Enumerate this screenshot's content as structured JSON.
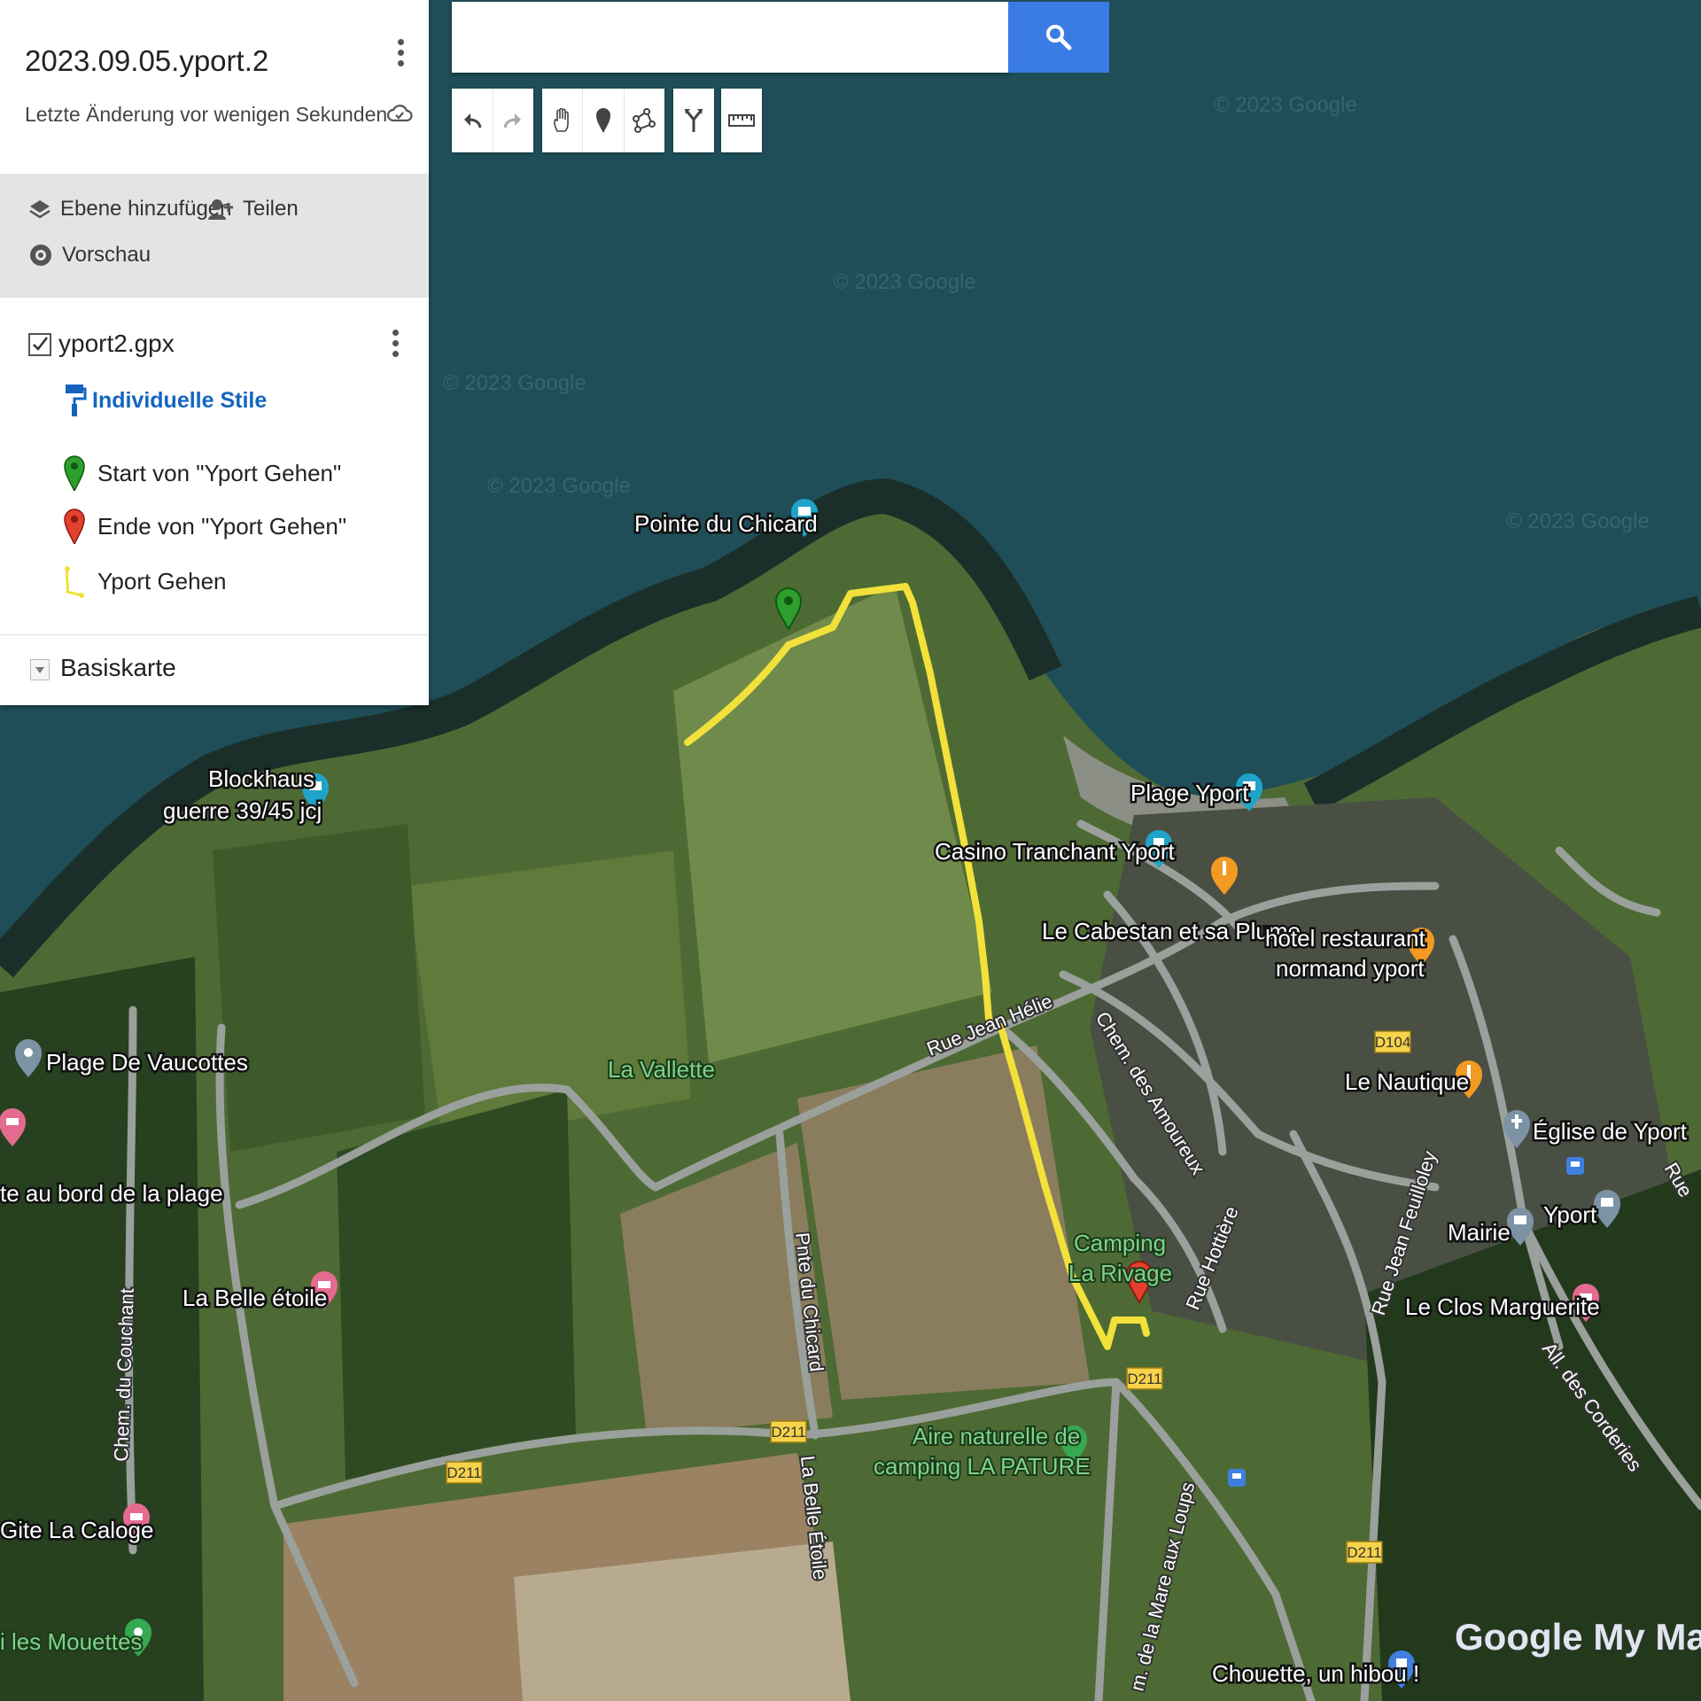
{
  "map_title": "2023.09.05.yport.2",
  "map_subtitle": "Letzte Änderung vor wenigen Sekunden",
  "actions": {
    "add_layer": "Ebene hinzufügen",
    "share": "Teilen",
    "preview": "Vorschau"
  },
  "layer": {
    "name": "yport2.gpx",
    "checked": true,
    "styles_label": "Individuelle Stile",
    "items": [
      {
        "label": "Start von \"Yport Gehen\"",
        "icon": "green-pin-icon",
        "color": "#2e9e2e"
      },
      {
        "label": "Ende von \"Yport Gehen\"",
        "icon": "red-pin-icon",
        "color": "#e3402f"
      },
      {
        "label": "Yport Gehen",
        "icon": "yellow-line-icon",
        "color": "#f1e13a"
      }
    ]
  },
  "basemap_label": "Basiskarte",
  "search": {
    "value": "",
    "placeholder": ""
  },
  "toolbar": [
    "undo-icon",
    "redo-icon",
    "hand-icon",
    "marker-icon",
    "draw-line-icon",
    "directions-icon",
    "ruler-icon"
  ],
  "map_labels": {
    "pointe": "Pointe du Chicard",
    "blockhaus_1": "Blockhaus",
    "blockhaus_2": "guerre 39/45 jcj",
    "plage_yport": "Plage Yport",
    "casino": "Casino Tranchant Yport",
    "cabestan": "Le Cabestan et sa Plume",
    "hotel_1": "hotel restaurant",
    "hotel_2": "normand yport",
    "vaucottes": "Plage De Vaucottes",
    "la_vallette": "La Vallette",
    "rue_jean_helie": "Rue Jean Hélie",
    "chem_amoureux": "Chem. des Amoureux",
    "le_nautique": "Le Nautique",
    "eglise": "Église de Yport",
    "bord_plage": "te au bord de la plage",
    "yport": "Yport",
    "mairie": "Mairie",
    "rue_feuilloley": "Rue Jean Feuilloley",
    "rue_hottiere": "Rue Hottière",
    "camping_1": "Camping",
    "camping_2": "La Rivage",
    "belle_etoile": "La Belle étoile",
    "chem_couchant": "Chem. du Couchant",
    "pnte_chicard": "Pnte du Chicard",
    "la_belle_etoile_rd": "La Belle Étoile",
    "clos_marguerite": "Le Clos Marguerite",
    "all_corderies": "All. des Corderies",
    "aire_1": "Aire naturelle de",
    "aire_2": "camping LA PATURE",
    "gite": "Gite La Caloge",
    "mare_loups": "m. de la Mare aux Loups",
    "mouettes": "i les Mouettes",
    "chouette": "Chouette, un hibou !",
    "rue_partial": "Rue",
    "road_d211": "D211",
    "road_d104": "D104",
    "watermark": "© 2023 Google"
  },
  "logo": "Google My Maps"
}
